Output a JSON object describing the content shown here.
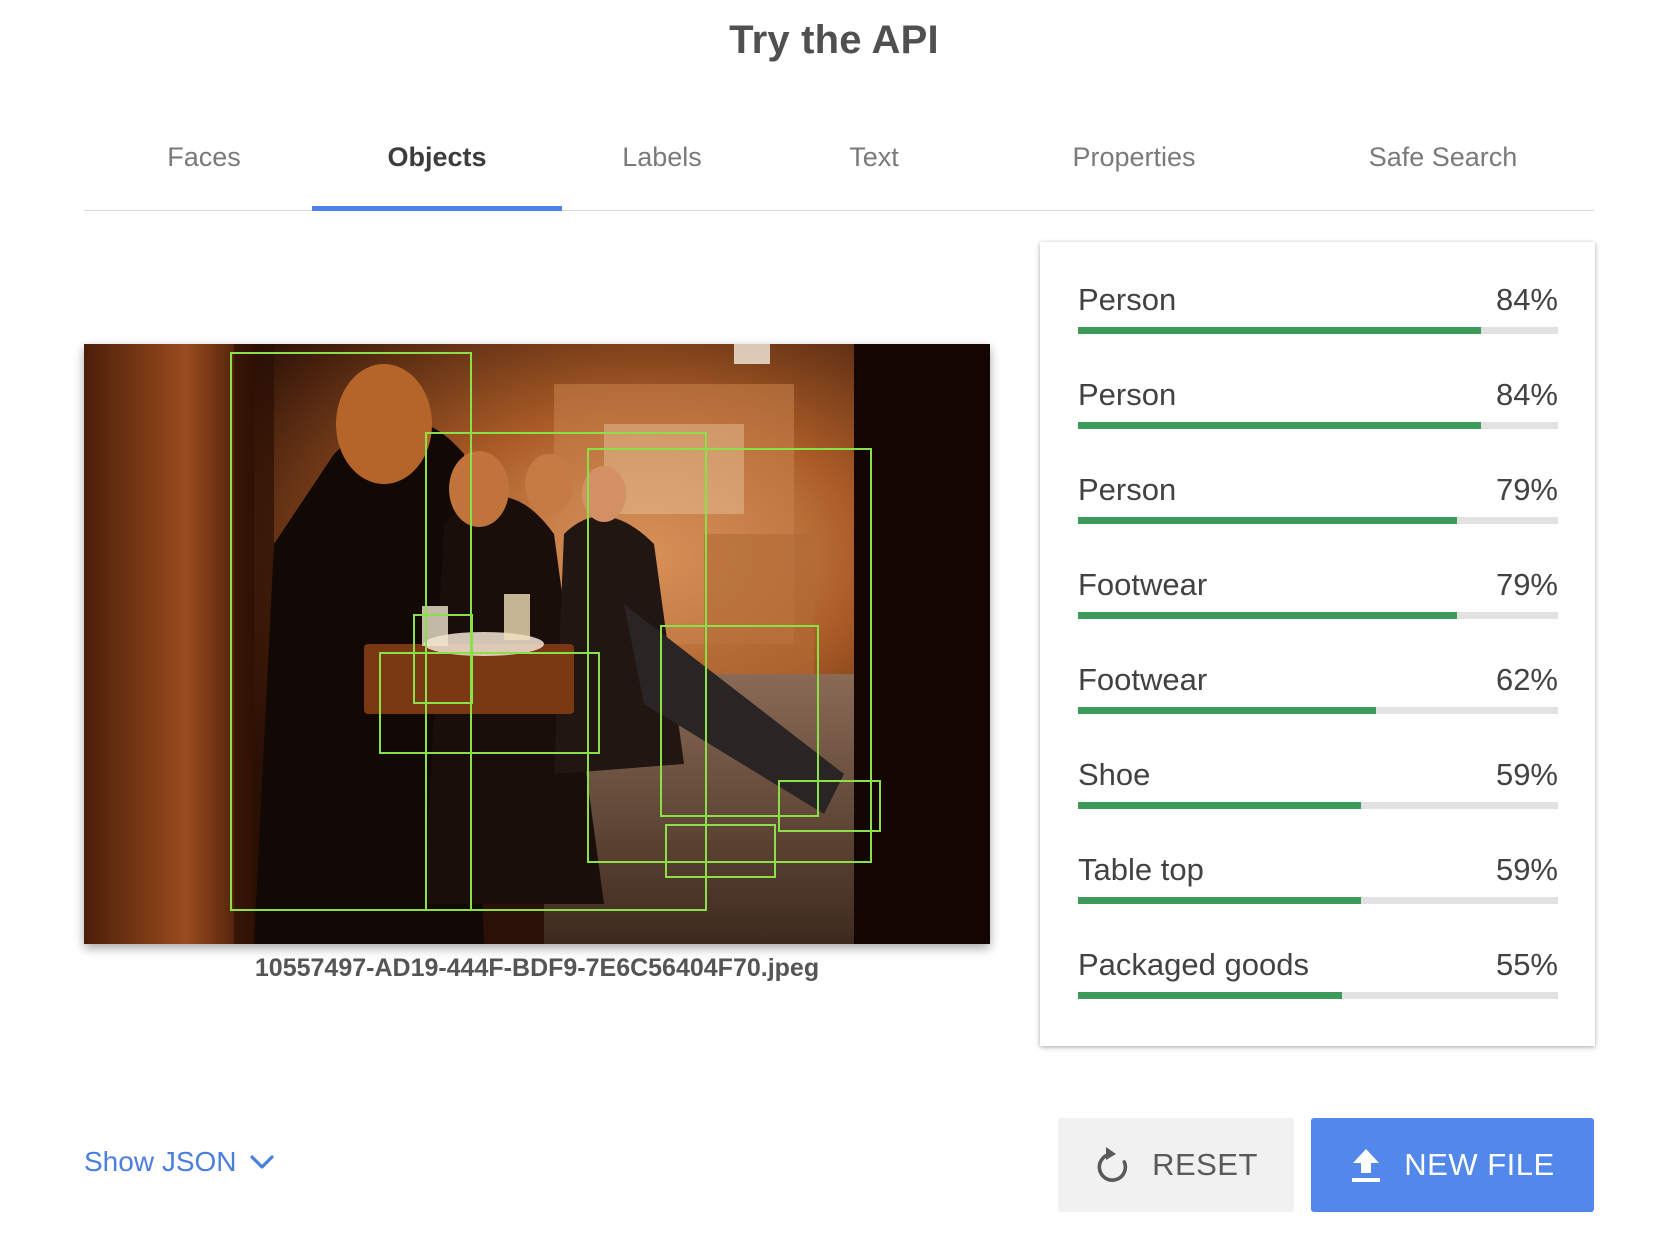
{
  "page_title": "Try the API",
  "tabs": [
    {
      "label": "Faces"
    },
    {
      "label": "Objects",
      "active": true
    },
    {
      "label": "Labels"
    },
    {
      "label": "Text"
    },
    {
      "label": "Properties"
    },
    {
      "label": "Safe Search"
    }
  ],
  "image": {
    "filename": "10557497-AD19-444F-BDF9-7E6C56404F70.jpeg",
    "bounding_box_color": "#8be04a"
  },
  "results": [
    {
      "label": "Person",
      "score": "84%",
      "value": 0.84
    },
    {
      "label": "Person",
      "score": "84%",
      "value": 0.84
    },
    {
      "label": "Person",
      "score": "79%",
      "value": 0.79
    },
    {
      "label": "Footwear",
      "score": "79%",
      "value": 0.79
    },
    {
      "label": "Footwear",
      "score": "62%",
      "value": 0.62
    },
    {
      "label": "Shoe",
      "score": "59%",
      "value": 0.59
    },
    {
      "label": "Table top",
      "score": "59%",
      "value": 0.59
    },
    {
      "label": "Packaged goods",
      "score": "55%",
      "value": 0.55
    }
  ],
  "colors": {
    "accent": "#4f82ea",
    "bar_fill": "#3c9b5a",
    "bar_track": "#e2e2e2",
    "new_file_bg": "#5288ea"
  },
  "show_json": {
    "label": "Show JSON",
    "icon": "chevron-down-icon"
  },
  "actions": {
    "reset_label": "RESET",
    "reset_icon": "refresh-icon",
    "new_file_label": "NEW FILE",
    "new_file_icon": "upload-icon"
  }
}
